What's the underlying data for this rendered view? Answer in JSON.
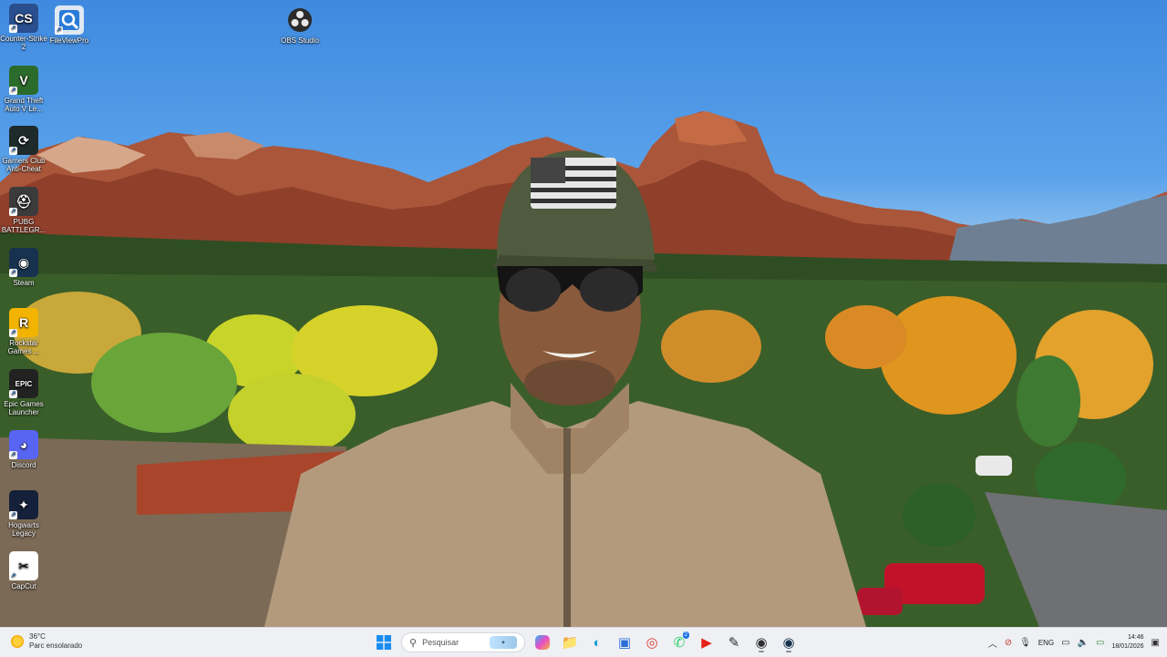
{
  "desktop": {
    "icons_left": [
      {
        "label": "Counter-Strike 2",
        "icon": "counter-strike-icon",
        "color": "#2a4f8f",
        "glyph": "CS"
      },
      {
        "label": "Grand Theft Auto V Le...",
        "icon": "gta-icon",
        "color": "#2b6b2b",
        "glyph": "V"
      },
      {
        "label": "Gamers Club Anti-Cheat",
        "icon": "gamers-club-icon",
        "color": "#1f2a2a",
        "glyph": "⟳"
      },
      {
        "label": "PUBG BATTLEGR...",
        "icon": "pubg-icon",
        "color": "#3b3b3b",
        "glyph": "⛑"
      },
      {
        "label": "Steam",
        "icon": "steam-icon",
        "color": "#17324f",
        "glyph": "◉"
      },
      {
        "label": "Rockstar Games ...",
        "icon": "rockstar-icon",
        "color": "#f2b400",
        "glyph": "R"
      },
      {
        "label": "Epic Games Launcher",
        "icon": "epic-games-icon",
        "color": "#222222",
        "glyph": "EPIC"
      },
      {
        "label": "Discord",
        "icon": "discord-icon",
        "color": "#5865f2",
        "glyph": "◕"
      },
      {
        "label": "Hogwarts Legacy",
        "icon": "hogwarts-icon",
        "color": "#15203a",
        "glyph": "✦"
      },
      {
        "label": "CapCut",
        "icon": "capcut-icon",
        "color": "#ffffff",
        "glyph": "✂"
      }
    ],
    "icon_fileviewpro": {
      "label": "FileViewPro",
      "icon": "fileviewpro-icon"
    },
    "icon_obs": {
      "label": "OBS Studio",
      "icon": "obs-studio-icon"
    }
  },
  "taskbar": {
    "weather_temp": "36°C",
    "weather_desc": "Parc ensolarado",
    "search_placeholder": "Pesquisar",
    "apps": [
      {
        "name": "file-explorer-icon",
        "glyph": "📁",
        "color": "#f4b400"
      },
      {
        "name": "edge-icon",
        "glyph": "◐",
        "color": "#1aa0d8"
      },
      {
        "name": "store-icon",
        "glyph": "▣",
        "color": "#2a6fd8"
      },
      {
        "name": "chrome-icon",
        "glyph": "◎",
        "color": "#db3b2e"
      },
      {
        "name": "whatsapp-icon",
        "glyph": "✆",
        "color": "#25d366",
        "badge": "2"
      },
      {
        "name": "youtube-icon",
        "glyph": "▶",
        "color": "#e62117"
      },
      {
        "name": "editor-icon",
        "glyph": "✎",
        "color": "#2c2c2c"
      },
      {
        "name": "obs-taskbar-icon",
        "glyph": "◉",
        "color": "#303030"
      },
      {
        "name": "steam-taskbar-icon",
        "glyph": "◉",
        "color": "#17324f"
      }
    ],
    "language": "ENG",
    "time": "14:46",
    "date": "18/01/2026"
  }
}
